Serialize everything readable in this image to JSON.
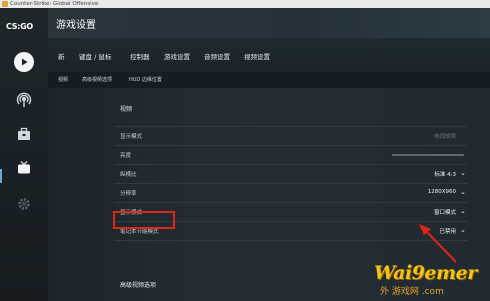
{
  "window": {
    "title": "Counter-Strike: Global Offensive"
  },
  "sidebar": {
    "logo": "CS:GO",
    "icons": [
      "play-icon",
      "broadcast-icon",
      "inventory-icon",
      "tv-icon",
      "gear-icon"
    ]
  },
  "header": {
    "title": "游戏设置"
  },
  "tabs": [
    "新",
    "键盘 / 鼠标",
    "控制器",
    "游戏设置",
    "音频设置",
    "视频设置"
  ],
  "active_tab": "视频设置",
  "subtabs": [
    "视频",
    "高级视频选项",
    "HUD 边缘位置"
  ],
  "panel": {
    "section_title": "视频",
    "rows": [
      {
        "label": "显示模式",
        "value": "电视故障",
        "disabled": true,
        "control": "text"
      },
      {
        "label": "亮度",
        "value": "",
        "control": "slider"
      },
      {
        "label": "纵横比",
        "value": "标准 4:3",
        "control": "dropdown"
      },
      {
        "label": "分辨率",
        "value": "1280X960",
        "control": "dropdown"
      },
      {
        "label": "显示模式",
        "value": "窗口模式",
        "control": "dropdown"
      },
      {
        "label": "笔记本节能模式",
        "value": "已禁用",
        "control": "dropdown"
      }
    ],
    "advanced_title": "高级视频选项"
  },
  "watermark": {
    "main": "Wai9emer",
    "sub": "游戏网 .com",
    "prefix": "外"
  },
  "colors": {
    "highlight": "#e0251b",
    "watermark": "#f0c419"
  }
}
